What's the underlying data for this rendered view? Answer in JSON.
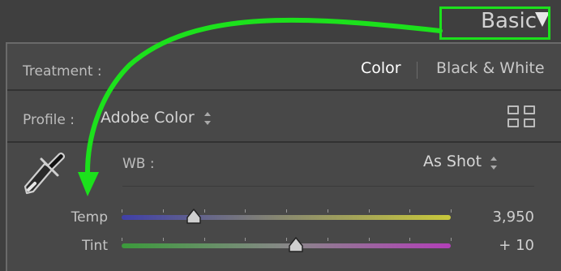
{
  "panel": {
    "title": "Basic"
  },
  "treatment": {
    "label": "Treatment :",
    "options": [
      "Color",
      "Black & White"
    ],
    "selected": "Color"
  },
  "profile": {
    "label": "Profile :",
    "value": "Adobe Color"
  },
  "wb": {
    "label": "WB :",
    "value": "As Shot"
  },
  "sliders": [
    {
      "label": "Temp",
      "value": "3,950",
      "level": 0.22
    },
    {
      "label": "Tint",
      "value": "+ 10",
      "level": 0.53
    }
  ],
  "colors": {
    "annotation": "#1ce11c",
    "panel_bg": "#484848"
  }
}
